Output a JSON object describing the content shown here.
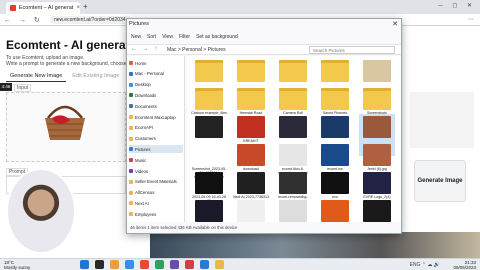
{
  "browser": {
    "tab_title": "Ecomtent – AI generated produ",
    "url": "new.ecomtent.ai/?order=0d2034-d14f5d9a3d3",
    "new_tab": "+",
    "nav_glyphs": "← → ↻",
    "ext_glyphs": "⋯",
    "win_glyphs": "─ ◻ ✕"
  },
  "app": {
    "title": "Ecomtent - AI generated pro",
    "desc1": "To use Ecomtent, upload an image.",
    "desc2": "Write a prompt to generate a new background, choose",
    "tabs": [
      "Generate New Image",
      "Edit Existing Image"
    ],
    "badge": "4:46",
    "input_label": "Input",
    "prompt_label": "Prompt",
    "generate_label": "Generate Image"
  },
  "dialog": {
    "title": "Pictures",
    "close": "✕",
    "toolbar": [
      "New",
      "Sort",
      "View",
      "Filter",
      "Set as background"
    ],
    "path": "Mac > Personal > Pictures",
    "path_nav": "← → ↑",
    "search_placeholder": "Search Pictures",
    "sidebar": [
      {
        "label": "Home",
        "color": "#e06030"
      },
      {
        "label": "Mac - Personal",
        "color": "#1e78d2"
      },
      {
        "label": "Desktop",
        "color": "#3a8ee6"
      },
      {
        "label": "Downloads",
        "color": "#2a7a3a"
      },
      {
        "label": "Documents",
        "color": "#4a6fa5"
      },
      {
        "label": "Ecomtent MaxLaptop",
        "color": "#e8b84a"
      },
      {
        "label": "EcomAPI",
        "color": "#e8b84a"
      },
      {
        "label": "Customers",
        "color": "#e8b84a"
      },
      {
        "label": "Pictures",
        "color": "#3a7bd5",
        "selected": true
      },
      {
        "label": "Music",
        "color": "#d04050"
      },
      {
        "label": "Videos",
        "color": "#7040b0"
      },
      {
        "label": "Seller Event Materials",
        "color": "#e8b84a"
      },
      {
        "label": "AllCensus",
        "color": "#e8b84a"
      },
      {
        "label": "Next AI",
        "color": "#e8b84a"
      },
      {
        "label": "Employees",
        "color": "#e8b84a"
      }
    ],
    "files": [
      {
        "name": "",
        "color": "#f2c94c"
      },
      {
        "name": "",
        "color": "#f2c94c"
      },
      {
        "name": "",
        "color": "#f2c94c"
      },
      {
        "name": "",
        "color": "#f2c94c"
      },
      {
        "name": "",
        "color": "#d8c7a0"
      },
      {
        "name": "Cartoon example_files",
        "color": "#f2c94c"
      },
      {
        "name": "Hemstal Road",
        "color": "#f2c94c"
      },
      {
        "name": "Camera Roll",
        "color": "#f2c94c"
      },
      {
        "name": "Saved Pictures",
        "color": "#f2c94c"
      },
      {
        "name": "Screenshots",
        "color": "#f2c94c"
      },
      {
        "name": "",
        "color": "#222222"
      },
      {
        "name": "BREAKIT",
        "color": "#c03020"
      },
      {
        "name": "",
        "color": "#2a2a3a"
      },
      {
        "name": "",
        "color": "#1a3a6a"
      },
      {
        "name": "",
        "color": "#9a5a3a",
        "selected": true
      },
      {
        "name": "Screenshot_2023-05-09_152219-removebg-preview",
        "color": "#ffffff"
      },
      {
        "name": "download",
        "color": "#c84a2a"
      },
      {
        "name": "ecomt-ition-6-removebg-preview",
        "color": "#e6e6e6"
      },
      {
        "name": "ecomt.ion",
        "color": "#1a4a8a"
      },
      {
        "name": "Jenki (6).jpg",
        "color": "#b06040"
      },
      {
        "name": "2023-05-09 16-40-28 (2)",
        "color": "#101010"
      },
      {
        "name": "Next AI-2023-7736313",
        "color": "#202020"
      },
      {
        "name": "ecom-removedbg-preview",
        "color": "#303030"
      },
      {
        "name": "evo",
        "color": "#111111"
      },
      {
        "name": "EVRE Logo_2(4)",
        "color": "#222244"
      },
      {
        "name": "",
        "color": "#1a1a2a"
      },
      {
        "name": "",
        "color": "#f0f0f0"
      },
      {
        "name": "CAPIBE",
        "color": "#dddddd"
      },
      {
        "name": "One Reboot Group",
        "color": "#e05a1a"
      },
      {
        "name": "",
        "color": "#1a1a1a"
      }
    ],
    "status": "46 items    1 item selected  436 KB    Available on this device"
  },
  "taskbar": {
    "weather_temp": "18°C",
    "weather_desc": "Mostly sunny",
    "time": "21:33",
    "date": "09/05/2023",
    "tray": "ENG ⌃ ☁ 🔊",
    "icons": [
      "#1e78d2",
      "#2a2a2a",
      "#e8a03a",
      "#3a8ee6",
      "#e05030",
      "#30a060",
      "#6a4ab0",
      "#d04040",
      "#2a7ad0",
      "#e8b84a"
    ]
  }
}
